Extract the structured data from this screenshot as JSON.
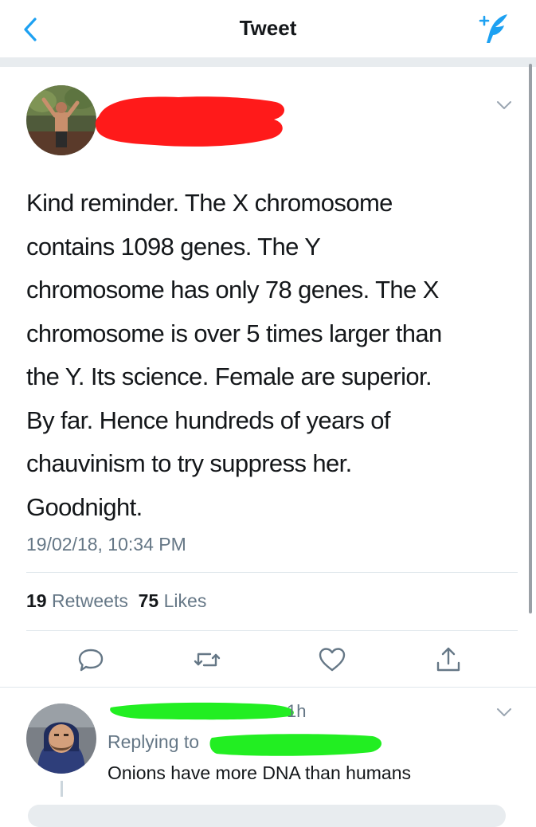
{
  "header": {
    "title": "Tweet"
  },
  "tweet": {
    "text_lines": [
      "Kind reminder. The X chromosome",
      "contains 1098 genes. The Y",
      "chromosome has only 78 genes. The X",
      "chromosome is over 5 times larger than",
      "the Y. Its science. Female are superior.",
      "By far. Hence hundreds of years of",
      "chauvinism to try suppress her.",
      "Goodnight."
    ],
    "timestamp": "19/02/18, 10:34 PM",
    "retweets_count": "19",
    "retweets_label": "Retweets",
    "likes_count": "75",
    "likes_label": "Likes"
  },
  "reply": {
    "time": "1h",
    "replying_to_label": "Replying to",
    "text": "Onions have more DNA than humans"
  },
  "icons": {
    "back": "chevron-left-icon",
    "compose": "compose-tweet-icon",
    "more": "chevron-down-icon",
    "reply": "reply-icon",
    "retweet": "retweet-icon",
    "like": "heart-icon",
    "share": "share-icon"
  },
  "colors": {
    "accent": "#1da1f2",
    "muted": "#657786",
    "redaction_red": "#ff1a1a",
    "redaction_green": "#22ee22"
  }
}
